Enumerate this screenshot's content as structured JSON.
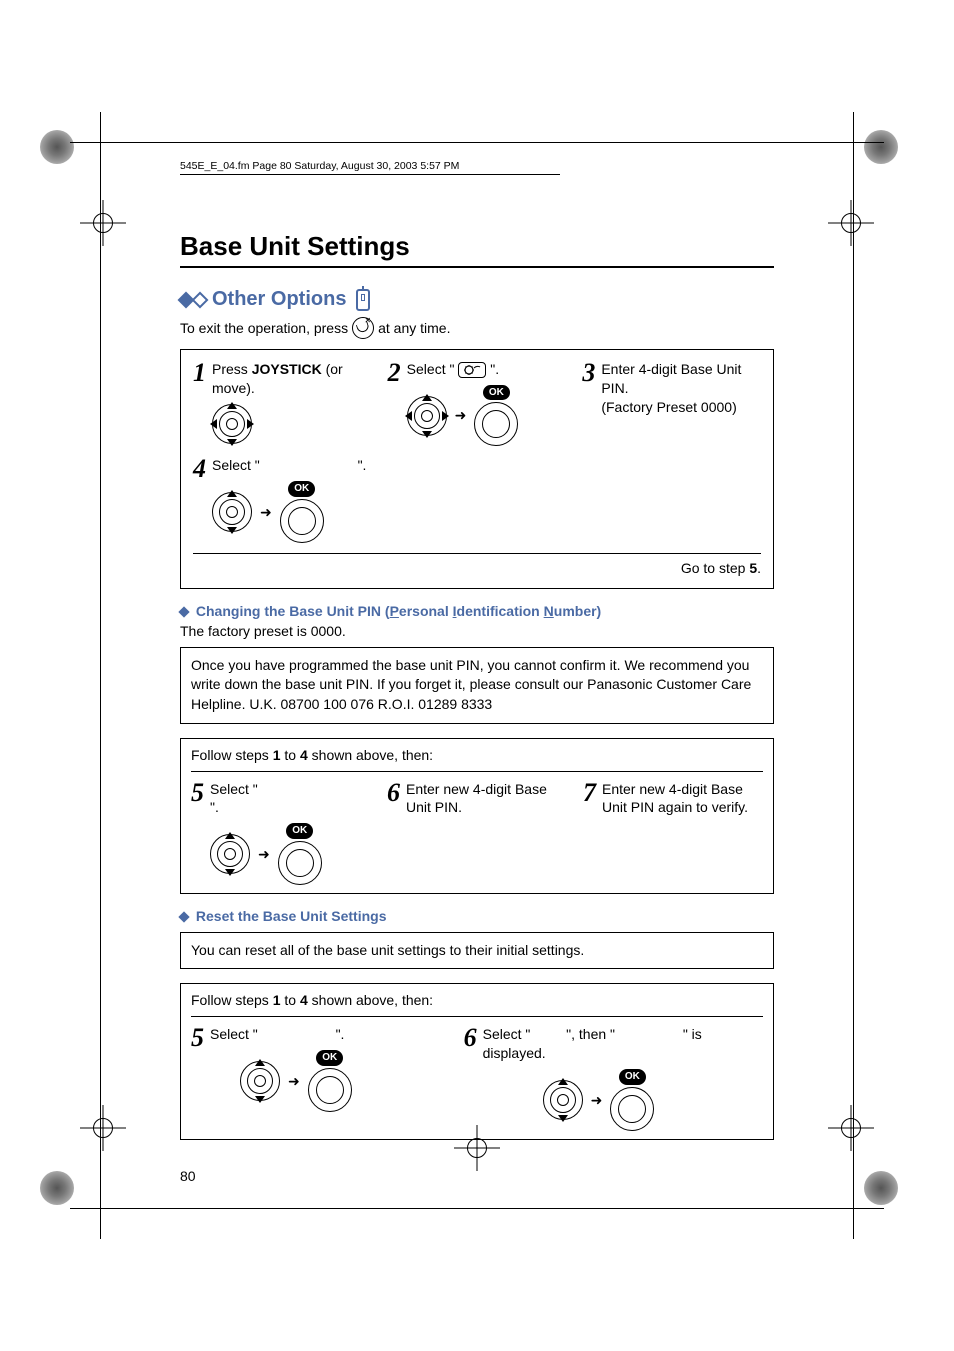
{
  "fm_header": "545E_E_04.fm  Page 80  Saturday, August 30, 2003  5:57 PM",
  "page_title": "Base Unit Settings",
  "section_title": "Other Options",
  "exit_prefix": "To exit the operation, press ",
  "exit_suffix": " at any time.",
  "steps": {
    "s1_a": "Press ",
    "s1_b": "JOYSTICK",
    "s1_c": " (or move).",
    "s2_a": "Select \"",
    "s2_b": "\".",
    "s3": "Enter 4-digit Base Unit PIN.\n(Factory Preset 0000)",
    "s4_a": "Select \"",
    "s4_b": "\"."
  },
  "ok_label": "OK",
  "goto_a": "Go to step ",
  "goto_b": "5",
  "goto_c": ".",
  "pin_heading": "Changing the Base Unit PIN (Personal Identification Number)",
  "pin_heading_prefix": "Changing the Base Unit PIN (",
  "pin_heading_P": "P",
  "pin_heading_mid1": "ersonal ",
  "pin_heading_I": "I",
  "pin_heading_mid2": "dentification ",
  "pin_heading_N": "N",
  "pin_heading_suffix": "umber)",
  "pin_sub": "The factory preset is 0000.",
  "pin_note": "Once you have programmed the base unit PIN, you cannot confirm it. We recommend you write down the base unit PIN. If you forget it, please consult our Panasonic Customer Care Helpline. U.K. 08700 100 076 R.O.I. 01289 8333",
  "follow_a": "Follow steps ",
  "follow_b": "1",
  "follow_c": " to ",
  "follow_d": "4",
  "follow_e": " shown above, then:",
  "pin_s5_a": "Select \"",
  "pin_s5_b": "\".",
  "pin_s6": "Enter new 4-digit Base Unit PIN.",
  "pin_s7": "Enter new 4-digit Base Unit PIN again to verify.",
  "reset_heading": "Reset the Base Unit Settings",
  "reset_note": "You can reset all of the base unit settings to their initial settings.",
  "reset_s5_a": "Select \"",
  "reset_s5_b": "\".",
  "reset_s6_a": "Select \"",
  "reset_s6_b": "\", then \"",
  "reset_s6_c": "\" is displayed.",
  "page_number": "80"
}
